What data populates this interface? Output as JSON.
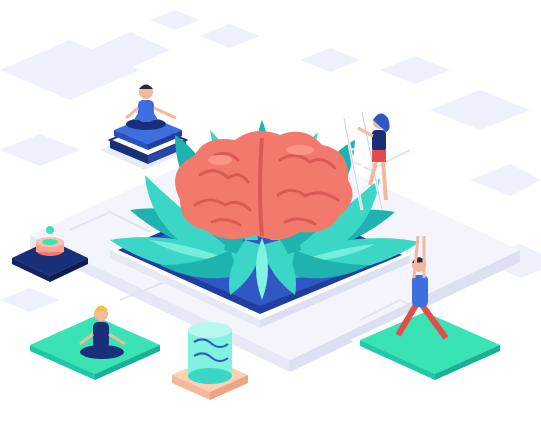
{
  "scene": {
    "subject": "meditation-brain-lotus-isometric",
    "palette": {
      "background": "#ffffff",
      "floor_tile": "#eef0fb",
      "floor_line": "#e0e3f2",
      "pond_water": "#2f58c4",
      "pond_dark": "#1e3f9e",
      "lotus_leaf": "#3bd6c6",
      "lotus_leaf_dark": "#1fb3b0",
      "lotus_leaf_light": "#7ff2e0",
      "brain": "#f27a6c",
      "brain_dark": "#d95a55",
      "brain_light": "#ffa08f",
      "mat_green": "#39e3b3",
      "mat_teal": "#1fc9a5",
      "navy": "#1a2f7a",
      "skin": "#f4b89a",
      "blue_shirt": "#3e6fe0",
      "red_pants": "#e24c4c"
    },
    "icons": [
      "meditating-person-icon",
      "yoga-warrior-person-icon",
      "ladder-person-icon",
      "sitting-yoga-person-icon",
      "incense-bowl-icon",
      "lantern-icon"
    ]
  }
}
